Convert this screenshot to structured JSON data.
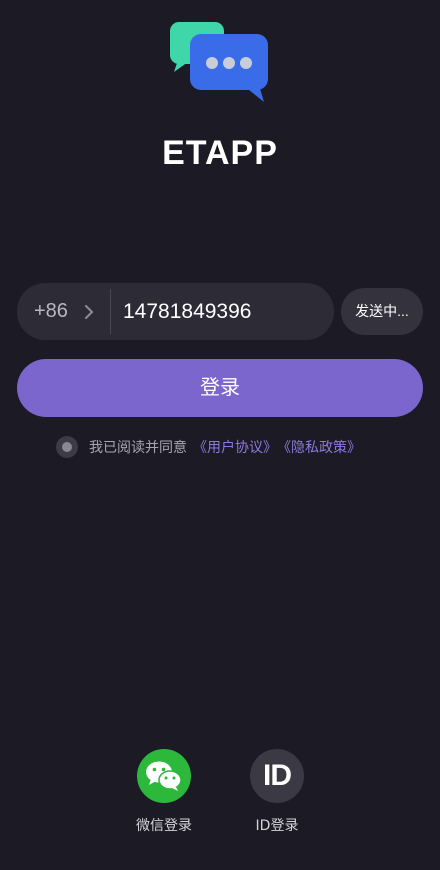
{
  "app": {
    "title": "ETAPP"
  },
  "phone": {
    "country_code": "+86",
    "number": "14781849396",
    "send_code_label": "发送中..."
  },
  "login": {
    "button_label": "登录"
  },
  "agreement": {
    "text": "我已阅读并同意",
    "user_agreement": "《用户协议》",
    "privacy_policy": "《隐私政策》"
  },
  "alt_logins": {
    "wechat_label": "微信登录",
    "id_label": "ID登录",
    "id_glyph": "ID"
  },
  "colors": {
    "background": "#1c1a24",
    "accent": "#7a66cc",
    "link": "#8c79e0",
    "wechat": "#2cb83a"
  }
}
